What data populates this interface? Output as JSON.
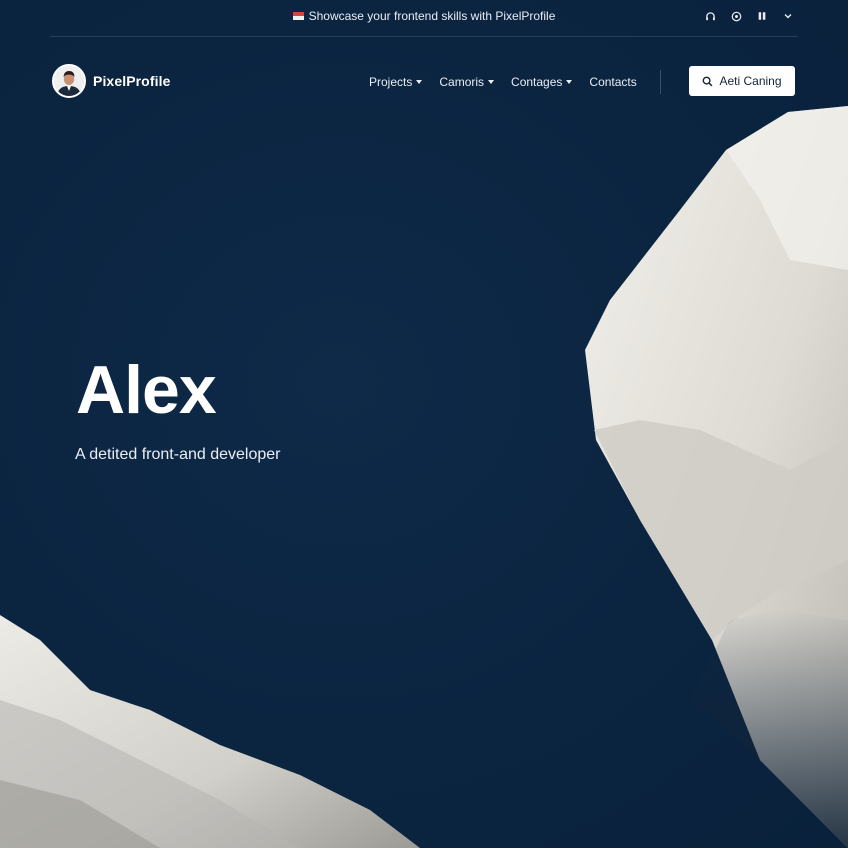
{
  "announcement": {
    "text": "Showcase your frontend skills with PixelProfile"
  },
  "nav": {
    "brand": "PixelProfile",
    "links": [
      {
        "label": "Projects",
        "has_dropdown": true
      },
      {
        "label": "Camoris",
        "has_dropdown": true
      },
      {
        "label": "Contages",
        "has_dropdown": true
      },
      {
        "label": "Contacts",
        "has_dropdown": false
      }
    ],
    "cta_label": "Aeti Caning"
  },
  "hero": {
    "title": "Alex",
    "subtitle": "A detited front-and developer"
  },
  "icons": {
    "util": [
      "headset-icon",
      "globe-icon",
      "bookmark-icon",
      "chevron-down-icon"
    ],
    "cta": "search-icon"
  },
  "colors": {
    "background": "#0b2440",
    "rock": "#e9e7e2",
    "text": "#ffffff",
    "accent_flag": "#d8443a"
  }
}
